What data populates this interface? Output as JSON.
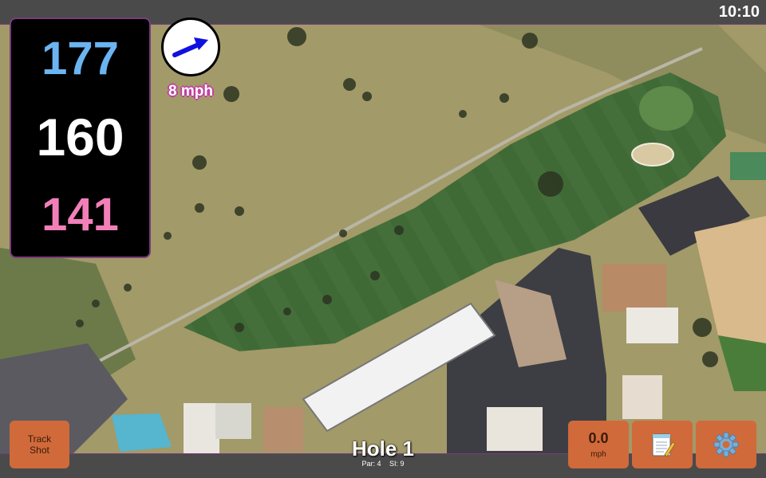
{
  "status": {
    "clock": "10:10"
  },
  "distances": {
    "back": "177",
    "middle": "160",
    "front": "141",
    "colors": {
      "back": "#6bb4f2",
      "middle": "#ffffff",
      "front": "#f27fb8"
    }
  },
  "wind": {
    "speed": "8 mph",
    "icon": "wind-arrow-icon"
  },
  "buttons": {
    "track_shot": "Track\nShot",
    "speed_value": "0.0",
    "speed_unit": "mph",
    "notes_icon": "notepad-icon",
    "settings_icon": "gear-icon"
  },
  "hole": {
    "title": "Hole 1",
    "par": "Par: 4",
    "si": "SI: 9"
  },
  "colors": {
    "accent_button": "#d06a3a",
    "panel_border": "#7a3d7a"
  }
}
